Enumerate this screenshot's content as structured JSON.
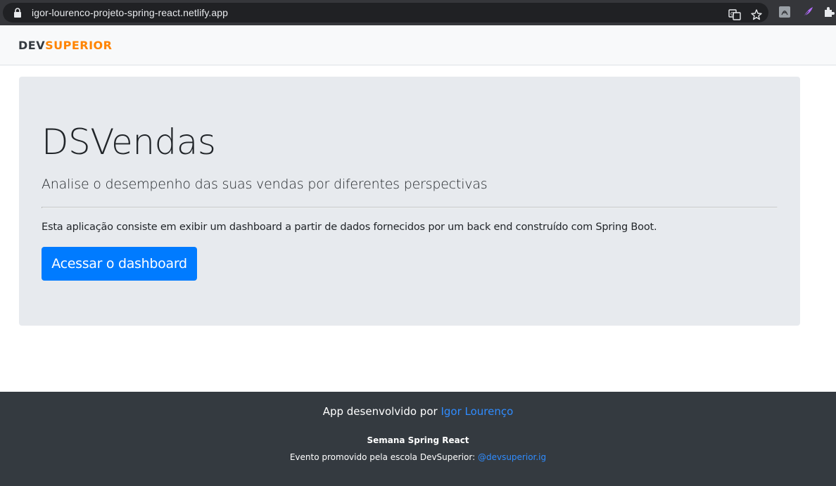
{
  "browser": {
    "url": "igor-lourenco-projeto-spring-react.netlify.app",
    "icons": [
      "lock-icon",
      "translate-icon",
      "star-icon",
      "pdf-extension-icon",
      "feather-extension-icon",
      "puzzle-extensions-icon"
    ]
  },
  "navbar": {
    "brand_part1": "DEV",
    "brand_part2": "SUPERIOR"
  },
  "jumbotron": {
    "title": "DSVendas",
    "lead": "Analise o desempenho das suas vendas por diferentes perspectivas",
    "text": "Esta aplicação consiste em exibir um dashboard a partir de dados fornecidos por um back end construído com Spring Boot.",
    "button_label": "Acessar o dashboard"
  },
  "footer": {
    "line1_prefix": "App desenvolvido por ",
    "line1_link": "Igor Lourenço",
    "line2": "Semana Spring React",
    "line3_prefix": "Evento promovido pela escola DevSuperior: ",
    "line3_link": "@devsuperior.ig"
  },
  "colors": {
    "brand_accent": "#ff8400",
    "primary": "#007bff",
    "footer_bg": "#343a40",
    "jumbotron_bg": "#e7eaee"
  }
}
